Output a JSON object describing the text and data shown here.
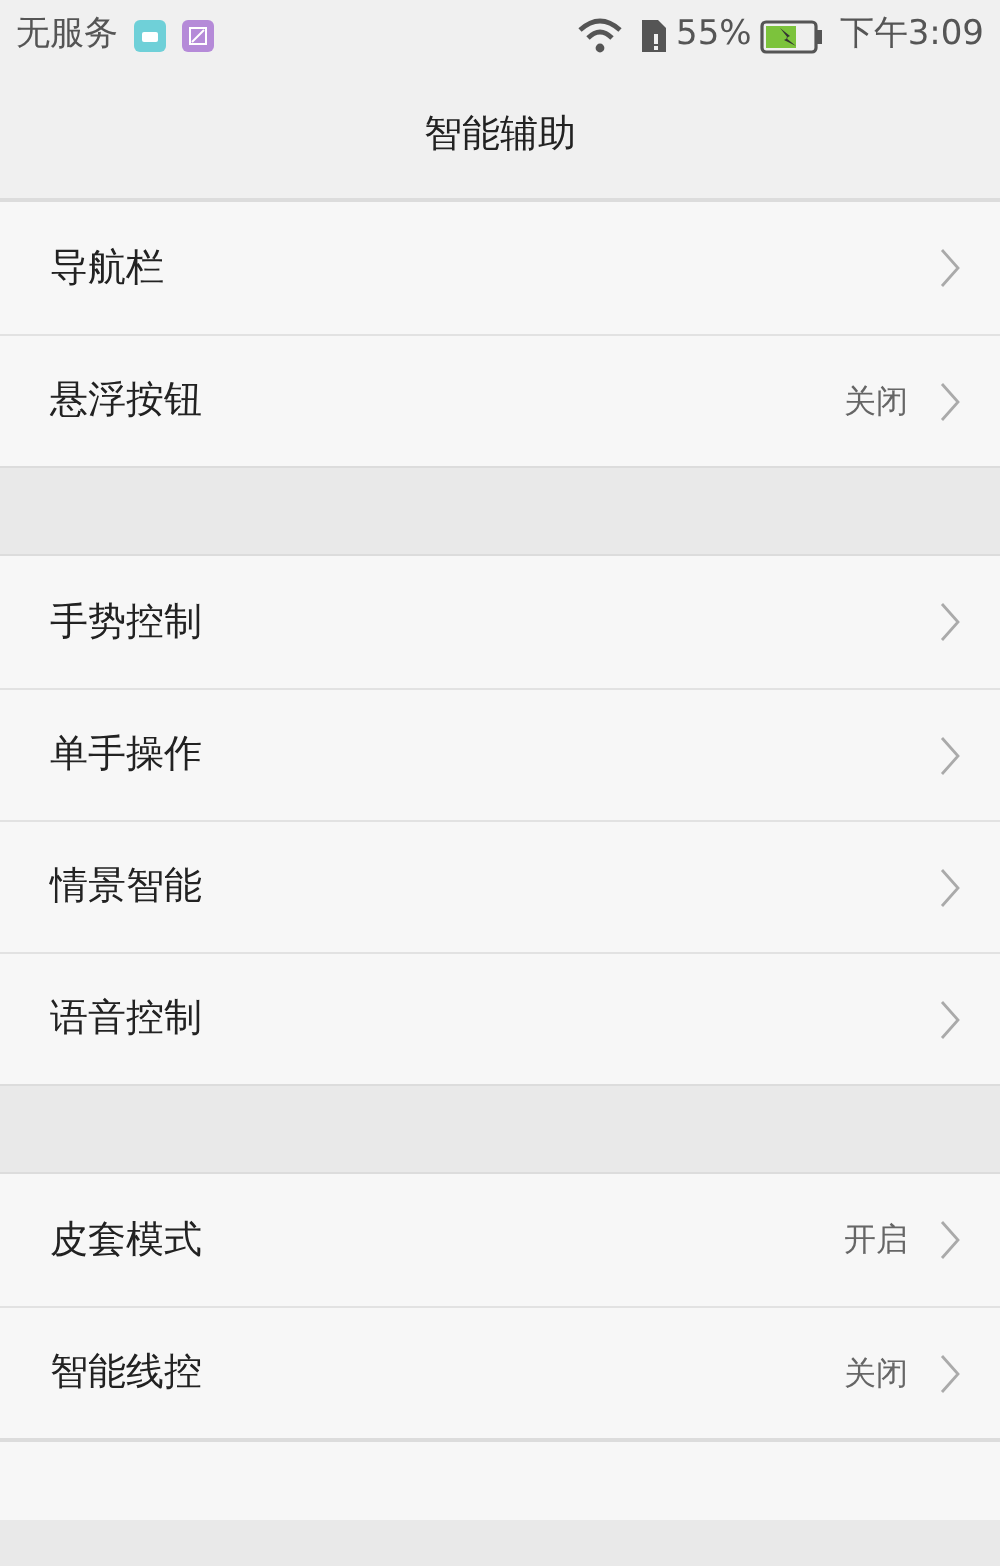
{
  "status_bar": {
    "carrier": "无服务",
    "battery": "55%",
    "time": "下午3:09"
  },
  "title": "智能辅助",
  "groups": [
    {
      "items": [
        {
          "label": "导航栏"
        },
        {
          "label": "悬浮按钮",
          "value": "关闭"
        }
      ]
    },
    {
      "items": [
        {
          "label": "手势控制"
        },
        {
          "label": "单手操作"
        },
        {
          "label": "情景智能"
        },
        {
          "label": "语音控制"
        }
      ]
    },
    {
      "items": [
        {
          "label": "皮套模式",
          "value": "开启"
        },
        {
          "label": "智能线控",
          "value": "关闭"
        }
      ]
    }
  ]
}
